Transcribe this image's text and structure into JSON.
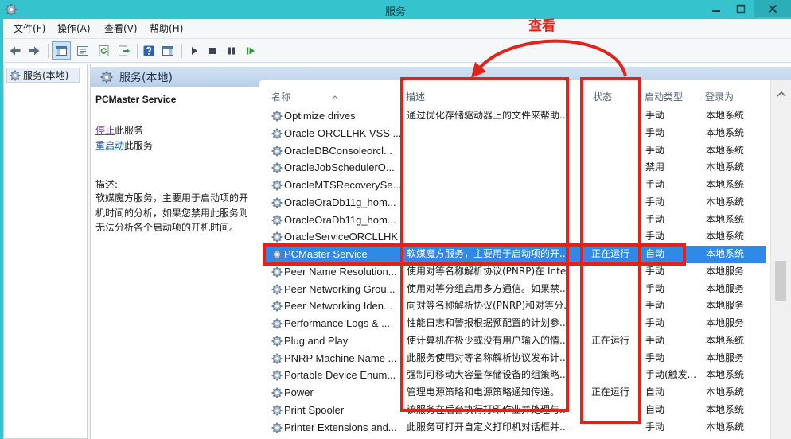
{
  "window": {
    "title": "服务"
  },
  "menu": {
    "file": "文件(F)",
    "action": "操作(A)",
    "view": "查看(V)",
    "help": "帮助(H)"
  },
  "toolbar_icons": [
    "back-arrow-icon",
    "forward-arrow-icon",
    "show-hide-console-tree-icon",
    "properties-icon",
    "refresh-icon",
    "export-list-icon",
    "help-icon",
    "show-hide-action-pane-icon",
    "start-service-icon",
    "stop-service-icon",
    "pause-service-icon",
    "restart-service-icon"
  ],
  "tree": {
    "root_label": "服务(本地)"
  },
  "header": {
    "title": "服务(本地)"
  },
  "detail": {
    "service_name": "PCMaster Service",
    "stop_link": "停止",
    "stop_suffix": "此服务",
    "restart_link": "重启动",
    "restart_suffix": "此服务",
    "desc_label": "描述:",
    "desc_text": "软媒魔方服务，主要用于启动项的开机时间的分析，如果您禁用此服务则无法分析各个启动项的开机时间。"
  },
  "services": {
    "columns": {
      "name": "名称",
      "description": "描述",
      "status": "状态",
      "startup_type": "启动类型",
      "log_on_as": "登录为"
    },
    "selected_index": 8,
    "rows": [
      {
        "name": "Optimize drives",
        "description": "通过优化存储驱动器上的文件来帮助...",
        "status": "",
        "startup_type": "手动",
        "log_on_as": "本地系统"
      },
      {
        "name": "Oracle ORCLLHK VSS ...",
        "description": "",
        "status": "",
        "startup_type": "手动",
        "log_on_as": "本地系统"
      },
      {
        "name": "OracleDBConsoleorcl...",
        "description": "",
        "status": "",
        "startup_type": "手动",
        "log_on_as": "本地系统"
      },
      {
        "name": "OracleJobSchedulerO...",
        "description": "",
        "status": "",
        "startup_type": "禁用",
        "log_on_as": "本地系统"
      },
      {
        "name": "OracleMTSRecoverySe...",
        "description": "",
        "status": "",
        "startup_type": "手动",
        "log_on_as": "本地系统"
      },
      {
        "name": "OracleOraDb11g_hom...",
        "description": "",
        "status": "",
        "startup_type": "手动",
        "log_on_as": "本地系统"
      },
      {
        "name": "OracleOraDb11g_hom...",
        "description": "",
        "status": "",
        "startup_type": "手动",
        "log_on_as": "本地系统"
      },
      {
        "name": "OracleServiceORCLLHK",
        "description": "",
        "status": "",
        "startup_type": "手动",
        "log_on_as": "本地系统"
      },
      {
        "name": "PCMaster Service",
        "description": "软媒魔方服务，主要用于启动项的开...",
        "status": "正在运行",
        "startup_type": "自动",
        "log_on_as": "本地系统"
      },
      {
        "name": "Peer Name Resolution...",
        "description": "使用对等名称解析协议(PNRP)在 Inter...",
        "status": "",
        "startup_type": "手动",
        "log_on_as": "本地服务"
      },
      {
        "name": "Peer Networking Grou...",
        "description": "使用对等分组启用多方通信。如果禁...",
        "status": "",
        "startup_type": "手动",
        "log_on_as": "本地服务"
      },
      {
        "name": "Peer Networking Iden...",
        "description": "向对等名称解析协议(PNRP)和对等分...",
        "status": "",
        "startup_type": "手动",
        "log_on_as": "本地服务"
      },
      {
        "name": "Performance Logs & ...",
        "description": "性能日志和警报根据预配置的计划参...",
        "status": "",
        "startup_type": "手动",
        "log_on_as": "本地服务"
      },
      {
        "name": "Plug and Play",
        "description": "使计算机在极少或没有用户输入的情...",
        "status": "正在运行",
        "startup_type": "手动",
        "log_on_as": "本地系统"
      },
      {
        "name": "PNRP Machine Name ...",
        "description": "此服务使用对等名称解析协议发布计...",
        "status": "",
        "startup_type": "手动",
        "log_on_as": "本地服务"
      },
      {
        "name": "Portable Device Enum...",
        "description": "强制可移动大容量存储设备的组策略...",
        "status": "",
        "startup_type": "手动(触发...",
        "log_on_as": "本地系统"
      },
      {
        "name": "Power",
        "description": "管理电源策略和电源策略通知传递。",
        "status": "正在运行",
        "startup_type": "自动",
        "log_on_as": "本地系统"
      },
      {
        "name": "Print Spooler",
        "description": "该服务在后台执行打印作业并处理与...",
        "status": "",
        "startup_type": "自动",
        "log_on_as": "本地系统"
      },
      {
        "name": "Printer Extensions and...",
        "description": "此服务可打开自定义打印机对话框并...",
        "status": "",
        "startup_type": "手动",
        "log_on_as": "本地系统"
      }
    ]
  },
  "annotation": {
    "label": "查看"
  },
  "colors": {
    "window_frame": "#35c3ce",
    "selection": "#2f8ae6",
    "annotation_red": "#e3231b",
    "link_visited": "#6a3ea1",
    "link": "#1d5fb8"
  }
}
